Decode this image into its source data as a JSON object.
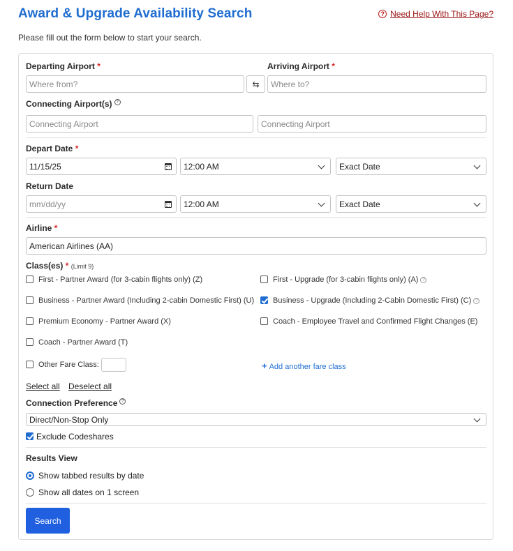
{
  "header": {
    "title": "Award & Upgrade Availability Search",
    "help_icon": "?",
    "help_link": "Need Help With This Page?",
    "intro": "Please fill out the form below to start your search."
  },
  "airports": {
    "departing_label": "Departing Airport",
    "departing_placeholder": "Where from?",
    "arriving_label": "Arriving Airport",
    "arriving_placeholder": "Where to?",
    "swap_icon": "⇆",
    "connecting_label": "Connecting Airport(s)",
    "connecting_placeholder_1": "Connecting Airport",
    "connecting_placeholder_2": "Connecting Airport",
    "required_mark": "*",
    "info_icon": "?"
  },
  "dates": {
    "depart_label": "Depart Date",
    "depart_value": "11/15/25",
    "depart_time": "12:00 AM",
    "depart_flex": "Exact Date",
    "return_label": "Return Date",
    "return_placeholder": "mm/dd/yy",
    "return_time": "12:00 AM",
    "return_flex": "Exact Date"
  },
  "airline": {
    "label": "Airline",
    "value": "American Airlines (AA)"
  },
  "classes": {
    "label": "Class(es)",
    "limit": "(Limit 9)",
    "items": [
      {
        "label": "First - Partner Award (for 3-cabin flights only) (Z)",
        "checked": false
      },
      {
        "label": "First - Upgrade (for 3-cabin flights only) (A)",
        "checked": false
      },
      {
        "label": "Business - Partner Award (Including 2-cabin Domestic First) (U)",
        "checked": false
      },
      {
        "label": "Business - Upgrade (Including 2-Cabin Domestic First) (C)",
        "checked": true
      },
      {
        "label": "Premium Economy - Partner Award (X)",
        "checked": false
      },
      {
        "label": "Coach - Employee Travel and Confirmed Flight Changes (E)",
        "checked": false
      },
      {
        "label": "Coach - Partner Award (T)",
        "checked": false
      }
    ],
    "other_label": "Other Fare Class:",
    "add_fare": "Add another fare class",
    "add_fare_icon": "+",
    "select_all": "Select all",
    "deselect_all": "Deselect all"
  },
  "connection": {
    "label": "Connection Preference",
    "value": "Direct/Non-Stop Only",
    "exclude_codeshares": "Exclude Codeshares"
  },
  "results": {
    "label": "Results View",
    "option_1": "Show tabbed results by date",
    "option_2": "Show all dates on 1 screen"
  },
  "search_button": "Search"
}
